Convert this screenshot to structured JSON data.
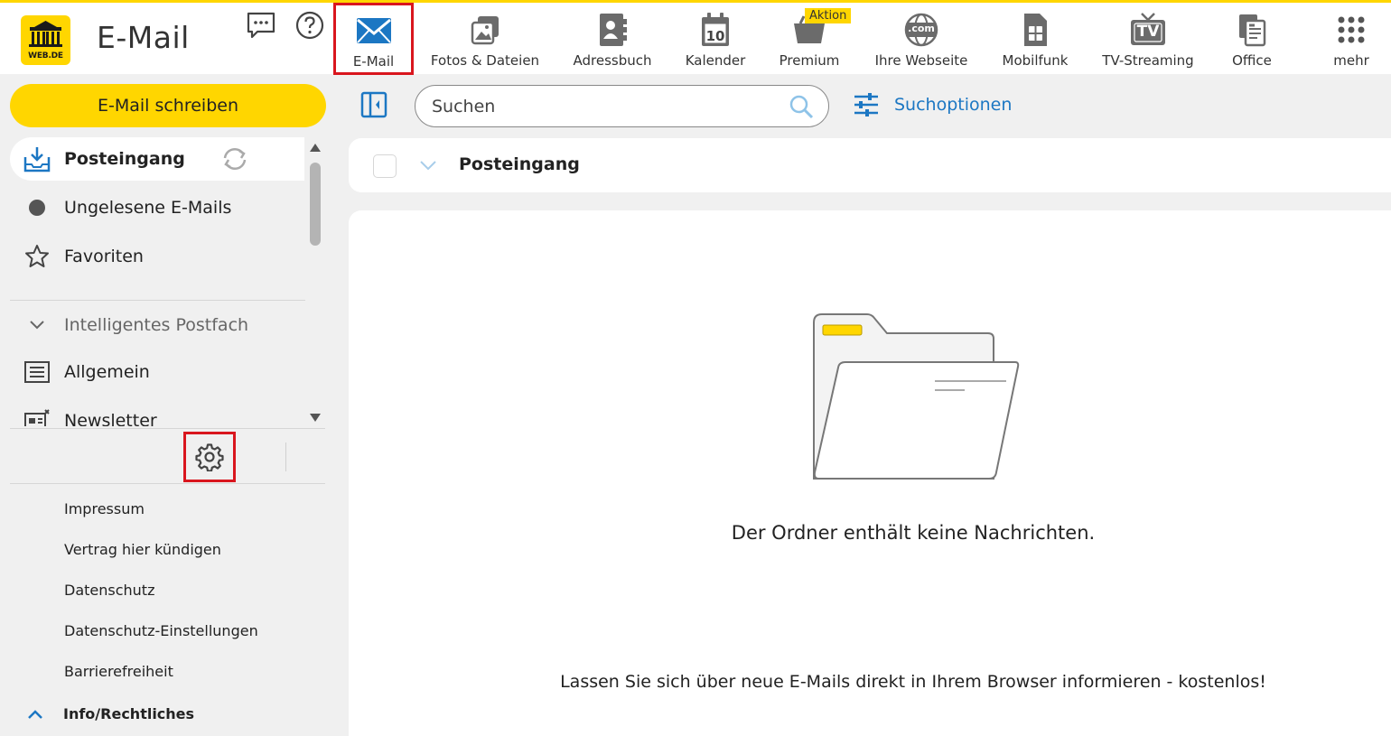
{
  "brand": {
    "logo_text": "WEB.DE",
    "app_title": "E-Mail",
    "accent": "#ffd600",
    "link_color": "#1c77c3",
    "highlight_color": "#d9161e"
  },
  "nav": {
    "items": [
      {
        "label": "E-Mail",
        "icon": "mail-icon",
        "active": true
      },
      {
        "label": "Fotos & Dateien",
        "icon": "photos-icon"
      },
      {
        "label": "Adressbuch",
        "icon": "address-book-icon"
      },
      {
        "label": "Kalender",
        "icon": "calendar-icon",
        "icon_text": "10"
      },
      {
        "label": "Premium",
        "icon": "premium-icon",
        "badge": "Aktion"
      },
      {
        "label": "Ihre Webseite",
        "icon": "globe-icon",
        "icon_text": ".com"
      },
      {
        "label": "Mobilfunk",
        "icon": "sim-card-icon"
      },
      {
        "label": "TV-Streaming",
        "icon": "tv-icon",
        "icon_text": "TV"
      },
      {
        "label": "Office",
        "icon": "office-icon"
      },
      {
        "label": "mehr",
        "icon": "apps-grid-icon"
      }
    ]
  },
  "sidebar": {
    "compose_label": "E-Mail schreiben",
    "folders": [
      {
        "label": "Posteingang",
        "icon": "inbox-icon",
        "selected": true
      },
      {
        "label": "Ungelesene E-Mails",
        "icon": "unread-dot-icon"
      },
      {
        "label": "Favoriten",
        "icon": "star-icon"
      }
    ],
    "smart_section_label": "Intelligentes Postfach",
    "smart_folders": [
      {
        "label": "Allgemein",
        "icon": "list-icon"
      },
      {
        "label": "Newsletter",
        "icon": "newsletter-icon"
      }
    ],
    "tools": [
      {
        "name": "settings",
        "icon": "gear-icon",
        "highlighted": true
      },
      {
        "name": "feedback",
        "icon": "chat-icon"
      },
      {
        "name": "help",
        "icon": "help-icon"
      }
    ],
    "footer_links": [
      "Impressum",
      "Vertrag hier kündigen",
      "Datenschutz",
      "Datenschutz-Einstellungen",
      "Barrierefreiheit"
    ],
    "footer_section_label": "Info/Rechtliches"
  },
  "main": {
    "search": {
      "placeholder": "Suchen",
      "value": ""
    },
    "search_options_label": "Suchoptionen",
    "list_header_title": "Posteingang",
    "empty_message": "Der Ordner enthält keine Nachrichten.",
    "notification_message": "Lassen Sie sich über neue E-Mails direkt in Ihrem Browser informieren - kostenlos!"
  }
}
